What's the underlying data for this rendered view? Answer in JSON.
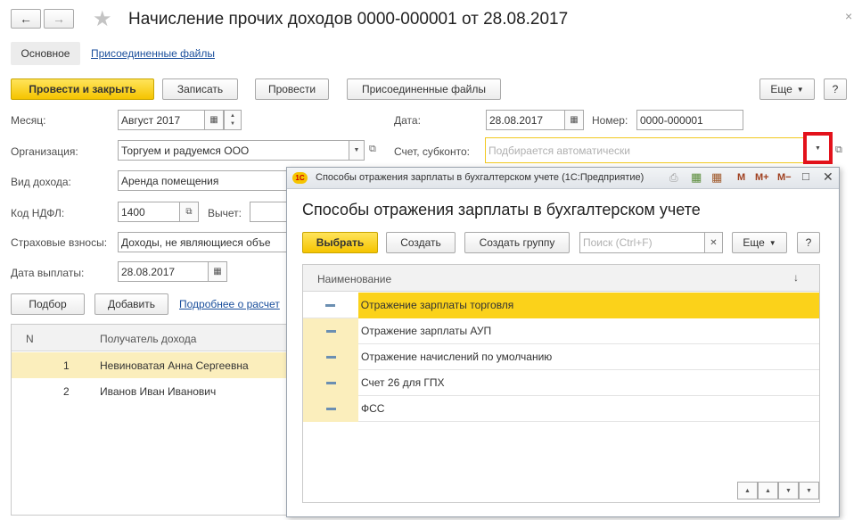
{
  "window": {
    "title": "Начисление прочих доходов 0000-000001 от 28.08.2017",
    "close_icon": "×"
  },
  "tabs": {
    "main": "Основное",
    "files": "Присоединенные файлы"
  },
  "toolbar": {
    "post_close": "Провести и закрыть",
    "write": "Записать",
    "post": "Провести",
    "attached": "Присоединенные файлы",
    "more": "Еще",
    "help": "?"
  },
  "form": {
    "month_label": "Месяц:",
    "month_value": "Август 2017",
    "date_label": "Дата:",
    "date_value": "28.08.2017",
    "number_label": "Номер:",
    "number_value": "0000-000001",
    "org_label": "Организация:",
    "org_value": "Торгуем и радуемся ООО",
    "account_label": "Счет, субконто:",
    "account_placeholder": "Подбирается автоматически",
    "income_type_label": "Вид дохода:",
    "income_type_value": "Аренда помещения",
    "ndfl_label": "Код НДФЛ:",
    "ndfl_value": "1400",
    "deduction_label": "Вычет:",
    "insurance_label": "Страховые взносы:",
    "insurance_value": "Доходы, не являющиеся объе",
    "pay_date_label": "Дата выплаты:",
    "pay_date_value": "28.08.2017"
  },
  "table_toolbar": {
    "pick": "Подбор",
    "add": "Добавить",
    "details_link": "Подробнее о расчет"
  },
  "table": {
    "col_n": "N",
    "col_recipient": "Получатель дохода",
    "rows": [
      {
        "n": "1",
        "name": "Невиноватая Анна Сергеевна"
      },
      {
        "n": "2",
        "name": "Иванов Иван Иванович"
      }
    ]
  },
  "dialog": {
    "window_title": "Способы отражения зарплаты в бухгалтерском учете  (1С:Предприятие)",
    "heading": "Способы отражения зарплаты в бухгалтерском учете",
    "select": "Выбрать",
    "create": "Создать",
    "create_group": "Создать группу",
    "search_placeholder": "Поиск (Ctrl+F)",
    "more": "Еще",
    "help": "?",
    "col_name": "Наименование",
    "sort_icon": "↓",
    "title_buttons": {
      "m": "M",
      "mplus": "M+",
      "mminus": "M−"
    },
    "rows": [
      "Отражение зарплаты торговля",
      "Отражение зарплаты АУП",
      "Отражение начислений по умолчанию",
      "Счет 26 для ГПХ",
      "ФСС"
    ]
  },
  "colors": {
    "accent_yellow": "#f5c400",
    "selected_row": "#fbd21a",
    "highlight_red": "#e3121b",
    "link_blue": "#1b4f9c"
  }
}
